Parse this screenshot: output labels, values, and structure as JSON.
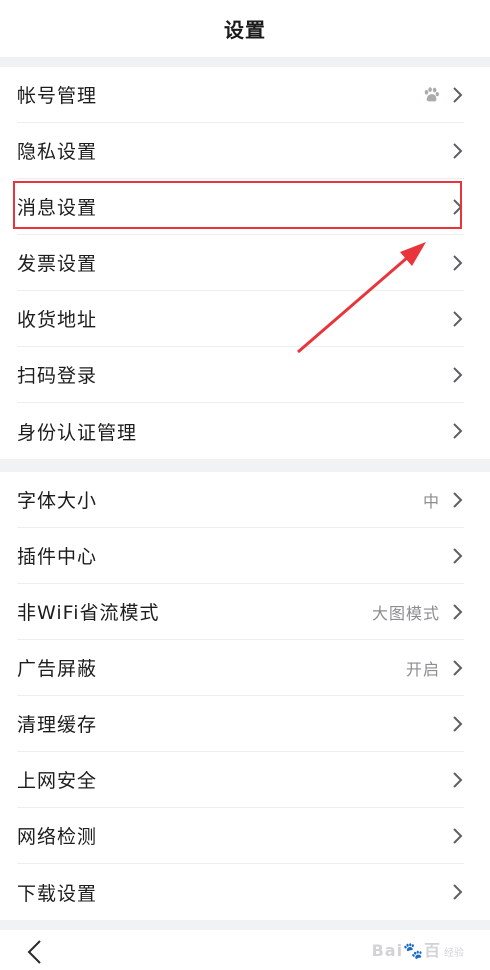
{
  "header": {
    "title": "设置"
  },
  "group1": [
    {
      "label": "帐号管理",
      "icon": "paw-icon"
    },
    {
      "label": "隐私设置"
    },
    {
      "label": "消息设置"
    },
    {
      "label": "发票设置"
    },
    {
      "label": "收货地址"
    },
    {
      "label": "扫码登录"
    },
    {
      "label": "身份认证管理"
    }
  ],
  "group2": [
    {
      "label": "字体大小",
      "value": "中"
    },
    {
      "label": "插件中心"
    },
    {
      "label": "非WiFi省流模式",
      "value": "大图模式"
    },
    {
      "label": "广告屏蔽",
      "value": "开启"
    },
    {
      "label": "清理缓存"
    },
    {
      "label": "上网安全"
    },
    {
      "label": "网络检测"
    },
    {
      "label": "下载设置"
    }
  ],
  "watermark": {
    "logo": "Bai🐾百",
    "sub": "经验"
  },
  "colors": {
    "highlight": "#e8343a",
    "divider": "#eceeef",
    "background": "#f1f2f4"
  }
}
